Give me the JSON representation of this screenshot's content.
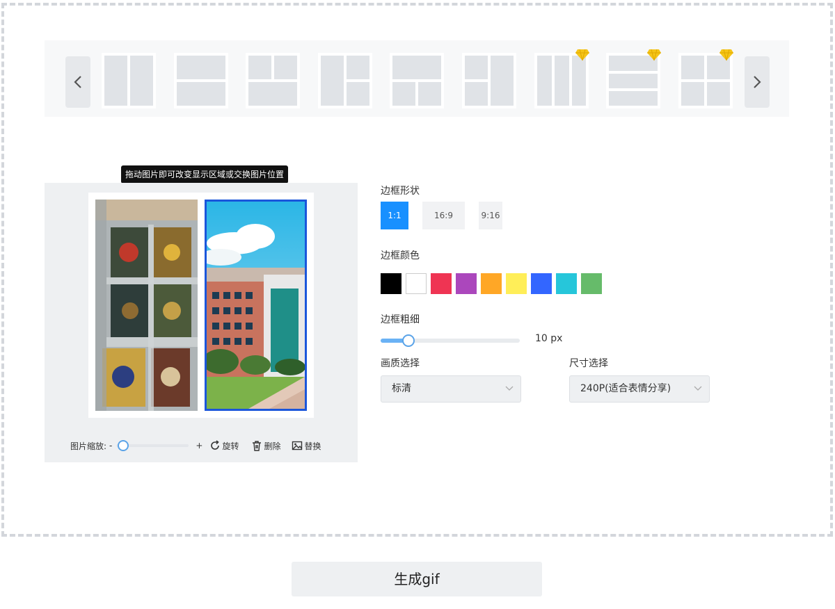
{
  "templates": {
    "prev_icon": "chevron-left-icon",
    "next_icon": "chevron-right-icon",
    "items": [
      {
        "name": "layout-2-vertical",
        "premium": false
      },
      {
        "name": "layout-2-horizontal",
        "premium": false
      },
      {
        "name": "layout-3-top-split",
        "premium": false
      },
      {
        "name": "layout-3-right-split",
        "premium": false
      },
      {
        "name": "layout-3-bottom-split",
        "premium": false
      },
      {
        "name": "layout-3-left-split",
        "premium": false
      },
      {
        "name": "layout-3-vertical",
        "premium": true
      },
      {
        "name": "layout-3-horizontal",
        "premium": true
      },
      {
        "name": "layout-4-grid",
        "premium": true
      }
    ],
    "premium_color": "#f5c518"
  },
  "preview": {
    "tooltip": "拖动图片即可改变显示区域或交换图片位置",
    "zoom_label": "图片缩放:",
    "zoom_minus": "-",
    "zoom_plus": "+",
    "zoom_level": 0.0,
    "rotate_label": "旋转",
    "delete_label": "删除",
    "replace_label": "替换",
    "selected_photo": "right",
    "selected_border_color": "#1a56db"
  },
  "settings": {
    "shape_label": "边框形状",
    "ratios": [
      "1:1",
      "16:9",
      "9:16"
    ],
    "active_ratio": "1:1",
    "color_label": "边框颜色",
    "colors": [
      "#000000",
      "#ffffff",
      "#ef3453",
      "#ab47bc",
      "#ffa726",
      "#ffee58",
      "#3366ff",
      "#26c6da",
      "#66bb6a"
    ],
    "thickness_label": "边框粗细",
    "thickness_value": "10",
    "thickness_unit": "px",
    "thickness_fraction": 0.2,
    "quality_label": "画质选择",
    "quality_value": "标清",
    "size_label": "尺寸选择",
    "size_value": "240P(适合表情分享)"
  },
  "generate_label": "生成gif",
  "accent": "#1890ff"
}
